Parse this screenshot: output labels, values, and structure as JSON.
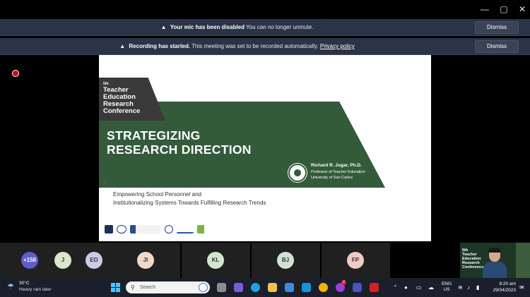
{
  "banners": [
    {
      "bold": "Your mic has been disabled",
      "text": "You can no longer unmute.",
      "link": "",
      "button": "Dismiss"
    },
    {
      "bold": "Recording has started.",
      "text": "This meeting was set to be recorded automatically.",
      "link": "Privacy policy",
      "button": "Dismiss"
    }
  ],
  "window": {
    "minimize": "—",
    "maximize": "▢",
    "close": "✕"
  },
  "slide": {
    "badge_sup": "5th",
    "badge_line1": "Teacher",
    "badge_line2": "Education",
    "badge_line3": "Research",
    "badge_line4": "Conference",
    "title_line1": "STRATEGIZING",
    "title_line2": "RESEARCH DIRECTION",
    "presenter_name": "Richard R. Jugar, Ph.D.",
    "presenter_role": "Professor of Teacher Education",
    "presenter_uni": "University of San Carlos",
    "subtitle_line1": "Empowering School Personnel and",
    "subtitle_line2": "Institutionalizing Systems Towards Fulfilling Research Trends"
  },
  "participants": [
    {
      "initials": "+158",
      "color": "#5b5fc7"
    },
    {
      "initials": "J",
      "color": "#d8e8c8"
    },
    {
      "initials": "EO",
      "color": "#c9cbe8"
    },
    {
      "initials": "JI",
      "color": "#f0d9c8"
    },
    {
      "initials": "KL",
      "color": "#d3e6d0"
    },
    {
      "initials": "BJ",
      "color": "#cfe3d3"
    },
    {
      "initials": "FP",
      "color": "#f2c9c4"
    }
  ],
  "camera": {
    "conf_line1": "5th",
    "conf_line2": "Teacher",
    "conf_line3": "Education",
    "conf_line4": "Research",
    "conf_line5": "Conference"
  },
  "taskbar": {
    "temp": "30°C",
    "condition": "Heavy rain later",
    "search_placeholder": "Search",
    "lang_line1": "ENG",
    "lang_line2": "US",
    "time": "8:20 am",
    "date": "29/04/2023",
    "messenger_badge": "2"
  }
}
